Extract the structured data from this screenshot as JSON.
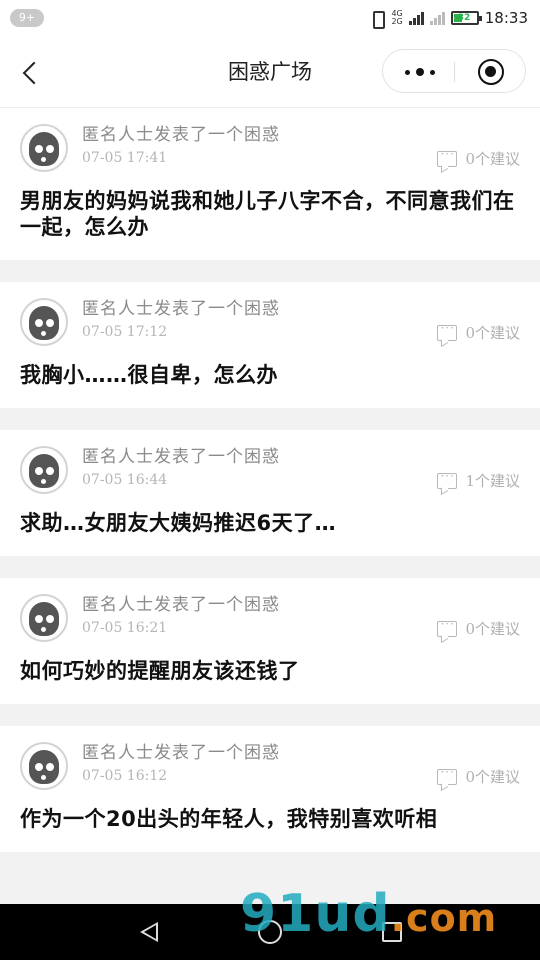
{
  "status_bar": {
    "notification_count": "9+",
    "net_top": "4G",
    "net_bottom": "2G",
    "battery": "32",
    "time": "18:33"
  },
  "navbar": {
    "title": "困惑广场"
  },
  "feed": {
    "posts": [
      {
        "author": "匿名人士发表了一个困惑",
        "time": "07-05 17:41",
        "advice": "0个建议",
        "title": "男朋友的妈妈说我和她儿子八字不合，不同意我们在一起，怎么办"
      },
      {
        "author": "匿名人士发表了一个困惑",
        "time": "07-05 17:12",
        "advice": "0个建议",
        "title": "我胸小……很自卑，怎么办"
      },
      {
        "author": "匿名人士发表了一个困惑",
        "time": "07-05 16:44",
        "advice": "1个建议",
        "title": "求助…女朋友大姨妈推迟6天了…"
      },
      {
        "author": "匿名人士发表了一个困惑",
        "time": "07-05 16:21",
        "advice": "0个建议",
        "title": "如何巧妙的提醒朋友该还钱了"
      },
      {
        "author": "匿名人士发表了一个困惑",
        "time": "07-05 16:12",
        "advice": "0个建议",
        "title": "作为一个20出头的年轻人，我特别喜欢听相"
      }
    ]
  },
  "watermark": {
    "brand": "91ud",
    "suffix": ".com"
  }
}
